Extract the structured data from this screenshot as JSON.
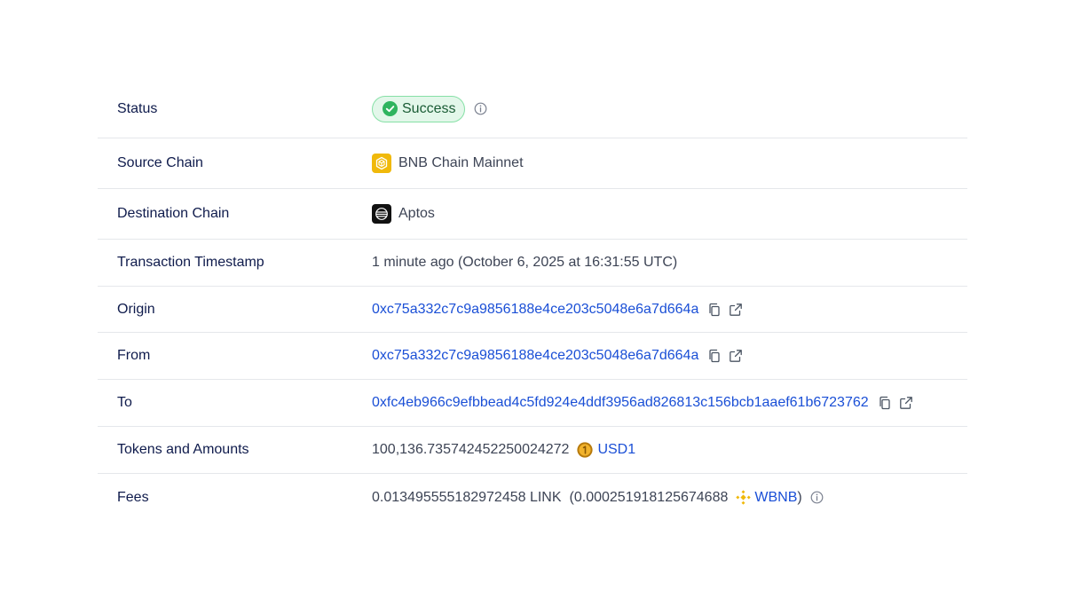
{
  "rows": {
    "status": {
      "label": "Status",
      "value": "Success"
    },
    "source_chain": {
      "label": "Source Chain",
      "value": "BNB Chain Mainnet",
      "icon": "bnb-chain-icon"
    },
    "destination_chain": {
      "label": "Destination Chain",
      "value": "Aptos",
      "icon": "aptos-icon"
    },
    "timestamp": {
      "label": "Transaction Timestamp",
      "value": "1 minute ago (October 6, 2025 at 16:31:55 UTC)"
    },
    "origin": {
      "label": "Origin",
      "value": "0xc75a332c7c9a9856188e4ce203c5048e6a7d664a"
    },
    "from": {
      "label": "From",
      "value": "0xc75a332c7c9a9856188e4ce203c5048e6a7d664a"
    },
    "to": {
      "label": "To",
      "value": "0xfc4eb966c9efbbead4c5fd924e4ddf3956ad826813c156bcb1aaef61b6723762"
    },
    "tokens": {
      "label": "Tokens and Amounts",
      "amount": "100,136.735742452250024272",
      "token": "USD1"
    },
    "fees": {
      "label": "Fees",
      "link_amount": "0.013495555182972458 LINK",
      "open_paren": "(",
      "native_amount": "0.000251918125674688",
      "native_token": "WBNB",
      "close_paren": ")"
    }
  },
  "colors": {
    "label": "#0f1b4c",
    "value": "#3d4455",
    "link": "#1a4fd6",
    "success_bg": "#e3f7ea",
    "success_border": "#86e0a6",
    "success_icon": "#2fb45f",
    "bnb_yellow": "#f0b90b",
    "divider": "#e5e7eb"
  }
}
